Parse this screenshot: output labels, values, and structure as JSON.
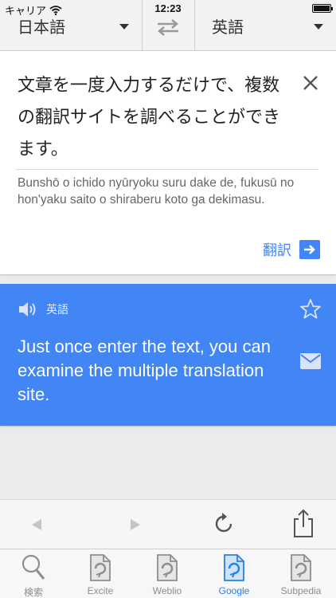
{
  "status": {
    "carrier": "キャリア",
    "time": "12:23"
  },
  "langbar": {
    "source_language": "日本語",
    "target_language": "英語"
  },
  "input": {
    "source_text": "文章を一度入力するだけで、複数の翻訳サイトを調べることができます。",
    "romanization": "Bunshō o ichido nyūryoku suru dake de, fukusū no hon'yaku saito o shiraberu koto ga dekimasu.",
    "translate_label": "翻訳"
  },
  "result": {
    "language": "英語",
    "text": "Just once enter the text, you can examine the multiple translation site."
  },
  "tabs": [
    {
      "label": "検索",
      "icon": "search-icon"
    },
    {
      "label": "Excite",
      "icon": "document-icon"
    },
    {
      "label": "Weblio",
      "icon": "document-icon"
    },
    {
      "label": "Google",
      "icon": "document-icon"
    },
    {
      "label": "Subpedia",
      "icon": "document-icon"
    }
  ],
  "active_tab": "Google",
  "colors": {
    "accent": "#4285f4",
    "active_tab": "#2b7fe3",
    "inactive": "#8e8e8e"
  }
}
